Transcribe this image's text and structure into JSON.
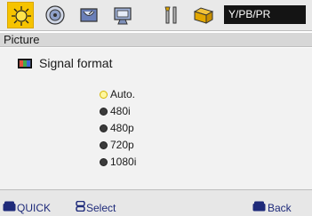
{
  "top_bar": {
    "tabs": [
      {
        "icon": "picture-sun-icon",
        "selected": true
      },
      {
        "icon": "sound-disc-icon",
        "selected": false
      },
      {
        "icon": "channel-dish-icon",
        "selected": false
      },
      {
        "icon": "features-screen-icon",
        "selected": false
      },
      {
        "icon": "setup-tools-icon",
        "selected": false
      },
      {
        "icon": "input-folder-icon",
        "selected": false
      }
    ],
    "source_label": "Y/PB/PR"
  },
  "section_title": "Picture",
  "content": {
    "item_label": "Signal format",
    "options": [
      {
        "label": "Auto.",
        "selected": true
      },
      {
        "label": "480i",
        "selected": false
      },
      {
        "label": "480p",
        "selected": false
      },
      {
        "label": "720p",
        "selected": false
      },
      {
        "label": "1080i",
        "selected": false
      }
    ]
  },
  "footer": {
    "quick_label": "QUICK",
    "select_label": "Select",
    "back_label": "Back"
  },
  "colors": {
    "selected_tab": "#f6c300",
    "source_box": "#141414",
    "footer_text": "#1e2a7a"
  }
}
